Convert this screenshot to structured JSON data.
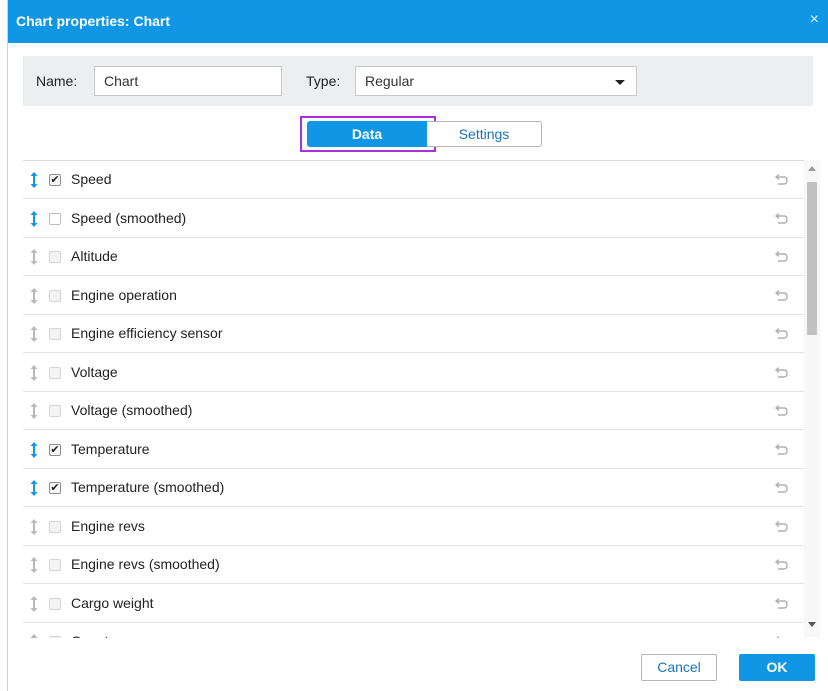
{
  "dialog": {
    "title": "Chart properties: Chart",
    "close_glyph": "×"
  },
  "form": {
    "name_label": "Name:",
    "name_value": "Chart",
    "type_label": "Type:",
    "type_value": "Regular"
  },
  "tabs": {
    "data_label": "Data",
    "settings_label": "Settings",
    "active": "Data"
  },
  "rows": [
    {
      "label": "Speed",
      "checked": true
    },
    {
      "label": "Speed (smoothed)",
      "checked": false,
      "enabled": true
    },
    {
      "label": "Altitude",
      "checked": false
    },
    {
      "label": "Engine operation",
      "checked": false
    },
    {
      "label": "Engine efficiency sensor",
      "checked": false
    },
    {
      "label": "Voltage",
      "checked": false
    },
    {
      "label": "Voltage (smoothed)",
      "checked": false
    },
    {
      "label": "Temperature",
      "checked": true
    },
    {
      "label": "Temperature (smoothed)",
      "checked": true
    },
    {
      "label": "Engine revs",
      "checked": false
    },
    {
      "label": "Engine revs (smoothed)",
      "checked": false
    },
    {
      "label": "Cargo weight",
      "checked": false
    },
    {
      "label": "Counter sensors",
      "checked": false
    }
  ],
  "footer": {
    "cancel_label": "Cancel",
    "ok_label": "OK"
  },
  "colors": {
    "accent": "#0f97e5",
    "highlight": "#a832d8",
    "handle_active": "#0f97e5",
    "handle_inactive": "#b9b9b9"
  },
  "icons": {
    "drag": "drag-handle-icon",
    "reset": "reset-icon",
    "check": "checkmark-icon"
  }
}
